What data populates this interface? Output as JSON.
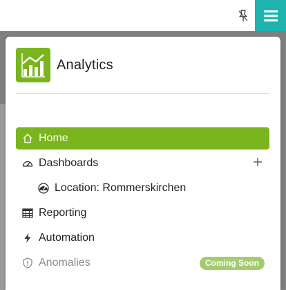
{
  "header": {
    "pin_icon": "pin-icon",
    "menu_icon": "hamburger-icon"
  },
  "brand": {
    "title": "Analytics",
    "logo_icon": "bar-chart-trend-icon",
    "accent_color": "#7ab51d"
  },
  "nav": {
    "items": [
      {
        "label": "Home",
        "icon": "home-icon",
        "active": true
      },
      {
        "label": "Dashboards",
        "icon": "gauge-icon",
        "action_icon": "plus-icon"
      },
      {
        "label": "Location: Rommerskirchen",
        "icon": "gauge-filled-icon",
        "sub": true
      },
      {
        "label": "Reporting",
        "icon": "table-icon"
      },
      {
        "label": "Automation",
        "icon": "bolt-icon"
      },
      {
        "label": "Anomalies",
        "icon": "shield-alert-icon",
        "disabled": true,
        "badge": "Coming Soon"
      }
    ]
  },
  "colors": {
    "teal": "#1fb3b0",
    "green": "#7ab51d",
    "badge_green": "#a3cc6c"
  }
}
